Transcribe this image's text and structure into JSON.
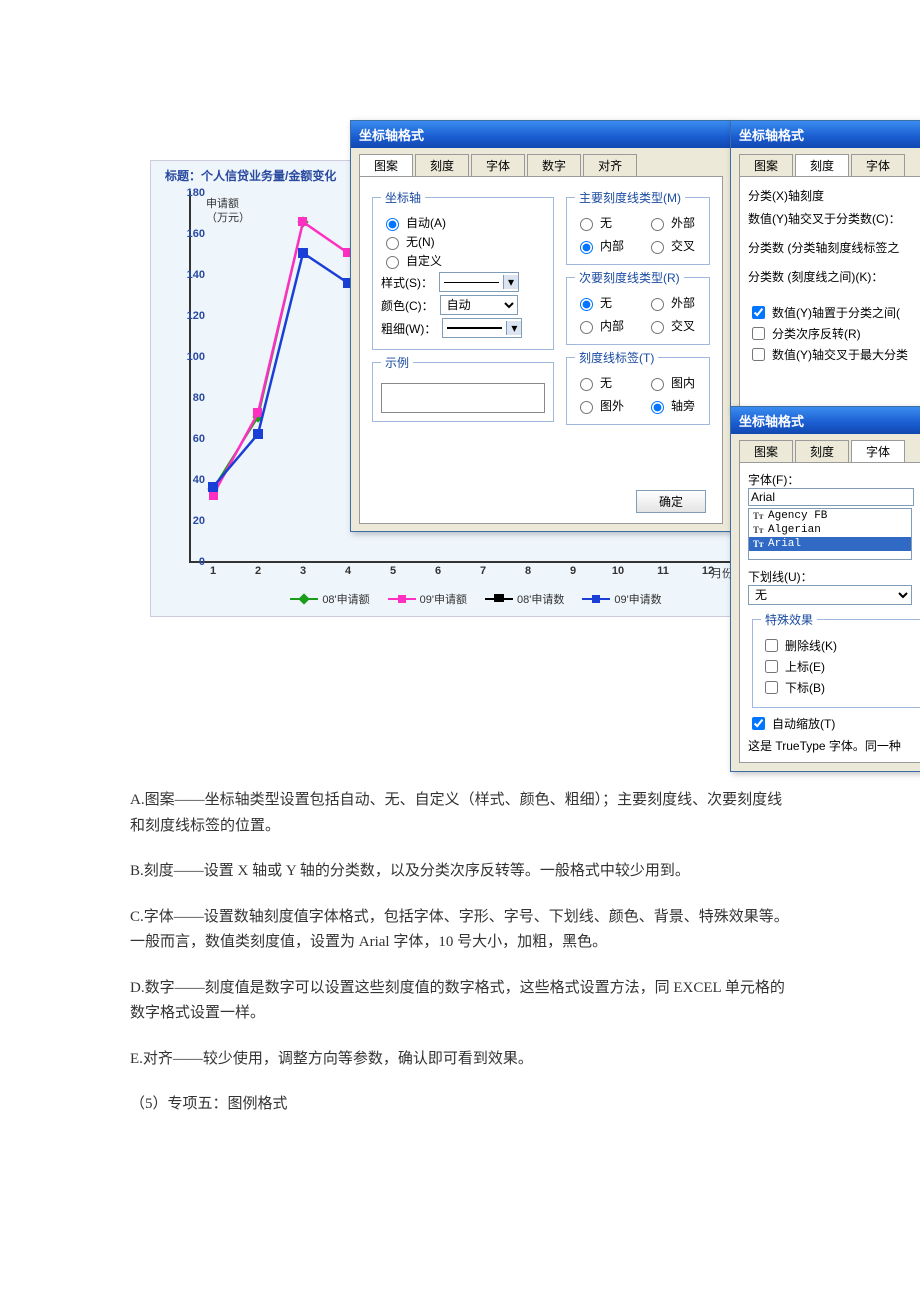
{
  "chart_data": {
    "type": "line",
    "title": "标题：个人信贷业务量/金额变化",
    "y_axis_note": "申请额\n（万元）",
    "xlabel": "月份",
    "x_categories": [
      1,
      2,
      3,
      4,
      5,
      6,
      7,
      8,
      9,
      10,
      11,
      12
    ],
    "ylim": [
      0,
      180
    ],
    "y_ticks": [
      0,
      20,
      40,
      60,
      80,
      100,
      120,
      140,
      160,
      180
    ],
    "series": [
      {
        "name": "08'申请额",
        "color": "#1a9e1a",
        "values": [
          35,
          70,
          165
        ]
      },
      {
        "name": "09'申请额",
        "color": "#ff2fc2",
        "values": [
          32,
          72,
          165,
          150
        ]
      },
      {
        "name": "08'申请数",
        "color": "#000000",
        "values": null
      },
      {
        "name": "09'申请数",
        "color": "#1a3fd6",
        "values": [
          36,
          62,
          150,
          135
        ]
      }
    ]
  },
  "dialog1": {
    "title": "坐标轴格式",
    "tabs": [
      "图案",
      "刻度",
      "字体",
      "数字",
      "对齐"
    ],
    "active_tab": "图案",
    "axis_group_label": "坐标轴",
    "axis_auto": "自动(A)",
    "axis_none": "无(N)",
    "axis_custom": "自定义",
    "style_label": "样式(S)：",
    "color_label": "颜色(C)：",
    "color_value": "自动",
    "weight_label": "粗细(W)：",
    "major_tick_label": "主要刻度线类型(M)",
    "minor_tick_label": "次要刻度线类型(R)",
    "tick_label_label": "刻度线标签(T)",
    "opt_none": "无",
    "opt_outside": "外部",
    "opt_inside": "内部",
    "opt_cross": "交叉",
    "opt_inside2": "图内",
    "opt_outside2": "图外",
    "opt_nextto": "轴旁",
    "sample_label": "示例",
    "ok": "确定"
  },
  "dialog2": {
    "title": "坐标轴格式",
    "tabs": [
      "图案",
      "刻度",
      "字体"
    ],
    "active_tab": "刻度",
    "heading": "分类(X)轴刻度",
    "row1": "数值(Y)轴交叉于分类数(C)：",
    "row2": "分类数 (分类轴刻度线标签之",
    "row3": "分类数 (刻度线之间)(K)：",
    "chk1": "数值(Y)轴置于分类之间(",
    "chk2": "分类次序反转(R)",
    "chk3": "数值(Y)轴交叉于最大分类"
  },
  "dialog3": {
    "title": "坐标轴格式",
    "tabs": [
      "图案",
      "刻度",
      "字体"
    ],
    "active_tab": "字体",
    "font_label": "字体(F)：",
    "font_value": "Arial",
    "font_list": [
      "Agency FB",
      "Algerian",
      "Arial"
    ],
    "underline_label": "下划线(U)：",
    "underline_value": "无",
    "effects_label": "特殊效果",
    "fx_strike": "删除线(K)",
    "fx_super": "上标(E)",
    "fx_sub": "下标(B)",
    "autoscale": "自动缩放(T)",
    "tt_note": "这是 TrueType 字体。同一种"
  },
  "body": {
    "pA": "A.图案——坐标轴类型设置包括自动、无、自定义（样式、颜色、粗细）；主要刻度线、次要刻度线和刻度线标签的位置。",
    "pB": "B.刻度——设置 X 轴或 Y 轴的分类数，以及分类次序反转等。一般格式中较少用到。",
    "pC": "C.字体——设置数轴刻度值字体格式，包括字体、字形、字号、下划线、颜色、背景、特殊效果等。一般而言，数值类刻度值，设置为 Arial 字体，10 号大小，加粗，黑色。",
    "pD": "D.数字——刻度值是数字可以设置这些刻度值的数字格式，这些格式设置方法，同 EXCEL 单元格的数字格式设置一样。",
    "pE": "E.对齐——较少使用，调整方向等参数，确认即可看到效果。",
    "p5": "（5）专项五：图例格式"
  }
}
